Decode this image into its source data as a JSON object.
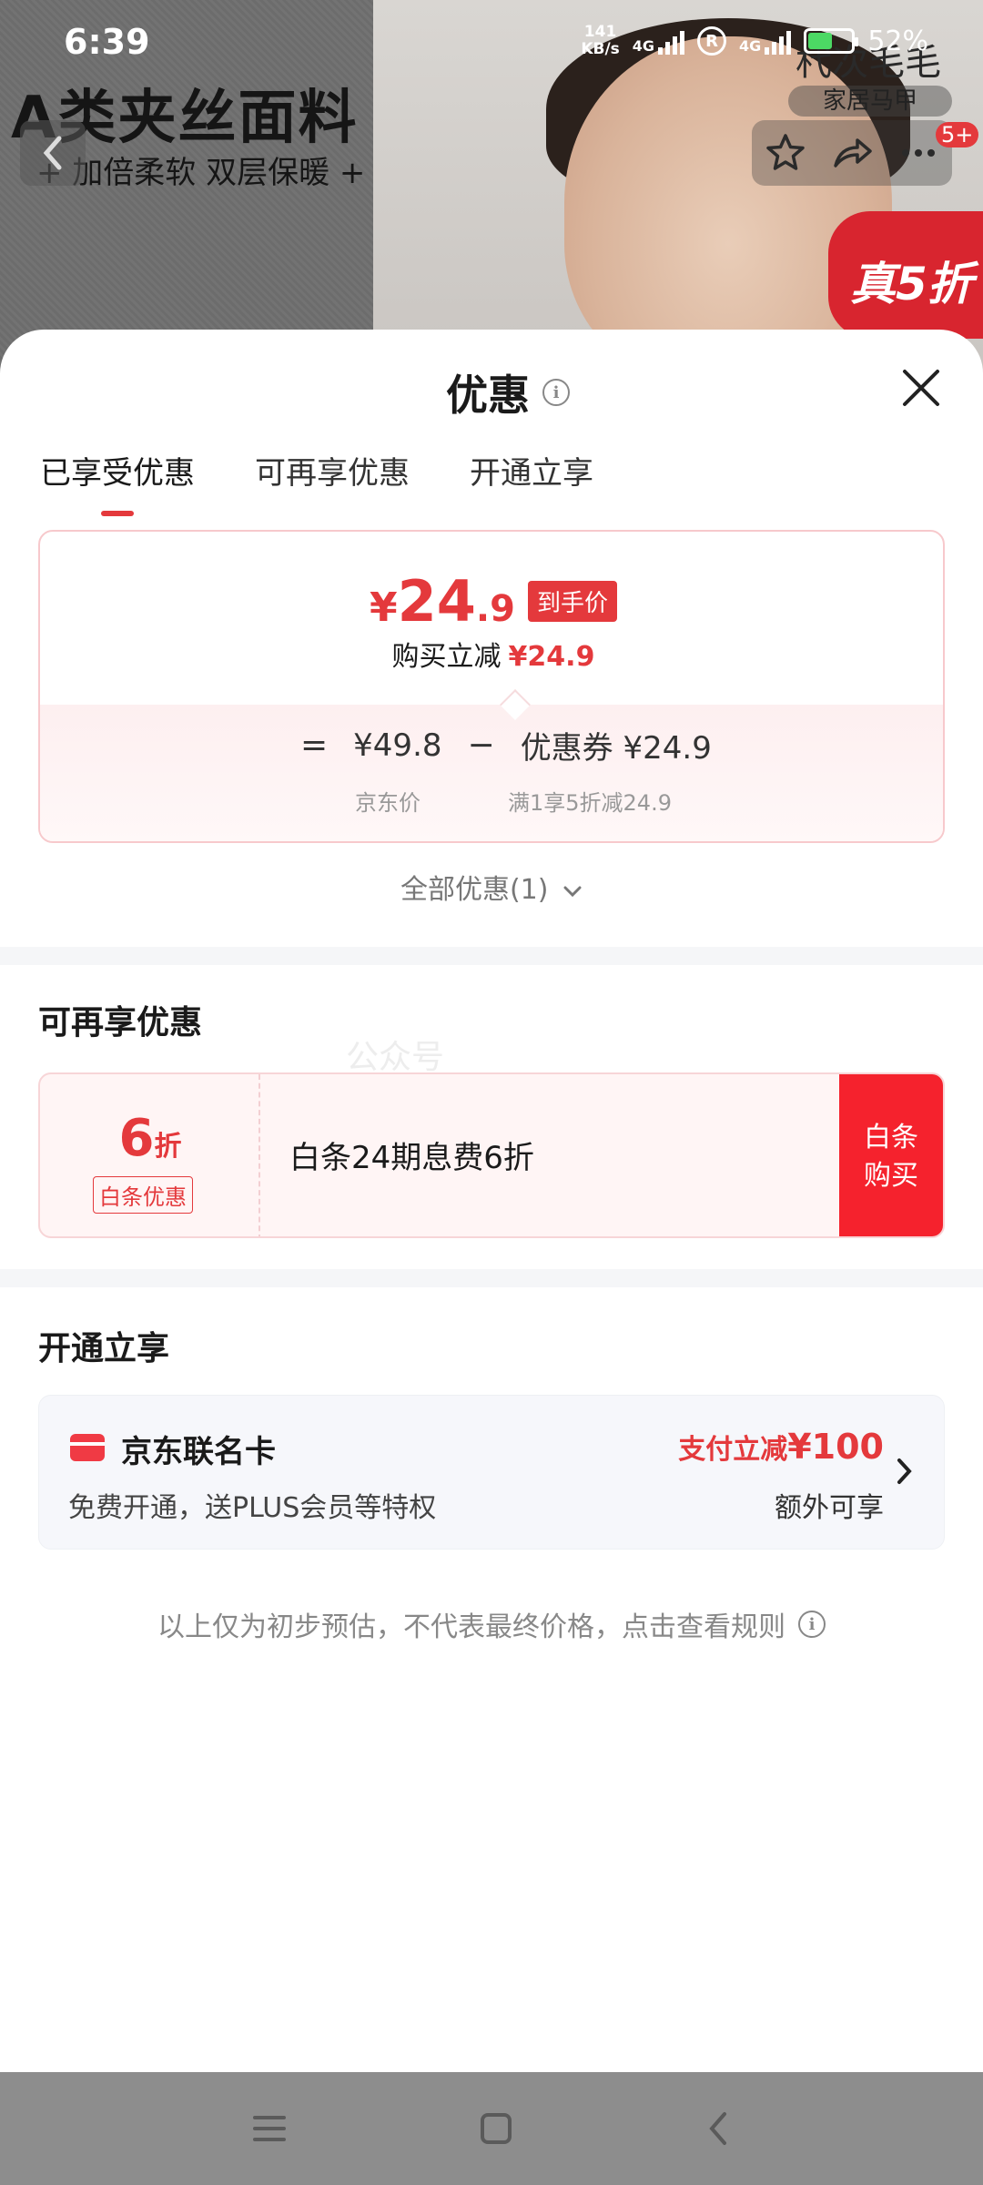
{
  "status_bar": {
    "time": "6:39",
    "net_speed_value": "141",
    "net_speed_unit": "KB/s",
    "network_1": "4G",
    "network_2": "4G",
    "battery_percent": "52%"
  },
  "background_page": {
    "ad_title": "A类夹丝面料",
    "ad_subtitle": "+ 加倍柔软 双层保暖 +",
    "brand_name": "杙次毛毛",
    "brand_tag": "家居马甲",
    "notification_badge": "5+",
    "promo_badge": "真5折"
  },
  "sheet": {
    "title": "优惠",
    "tabs": [
      {
        "label": "已享受优惠",
        "active": true
      },
      {
        "label": "可再享优惠",
        "active": false
      },
      {
        "label": "开通立享",
        "active": false
      }
    ],
    "price_card": {
      "currency": "¥",
      "price_int": "24",
      "price_dec": ".9",
      "price_tag": "到手价",
      "instant_reduce_label": "购买立减",
      "instant_reduce_value": "¥24.9",
      "eq": "=",
      "base_price": "¥49.8",
      "minus": "−",
      "coupon_label": "优惠券",
      "coupon_value": "¥24.9",
      "base_price_label": "京东价",
      "coupon_desc": "满1享5折减24.9"
    },
    "all_promos_label": "全部优惠(1)",
    "section_more": {
      "title": "可再享优惠",
      "watermark": "公众号"
    },
    "baitiao": {
      "discount_num": "6",
      "discount_unit": "折",
      "tag": "白条优惠",
      "desc": "白条24期息费6折",
      "button_line1": "白条",
      "button_line2": "购买"
    },
    "section_open": {
      "title": "开通立享"
    },
    "card": {
      "name": "京东联名卡",
      "desc": "免费开通，送PLUS会员等特权",
      "offer_prefix": "支付立减",
      "offer_value": "¥100",
      "extra": "额外可享"
    },
    "disclaimer": "以上仅为初步预估，不代表最终价格，点击查看规则"
  },
  "colors": {
    "accent_red": "#e4393c",
    "button_red": "#f5222d",
    "card_bg": "#f6f7fb"
  }
}
